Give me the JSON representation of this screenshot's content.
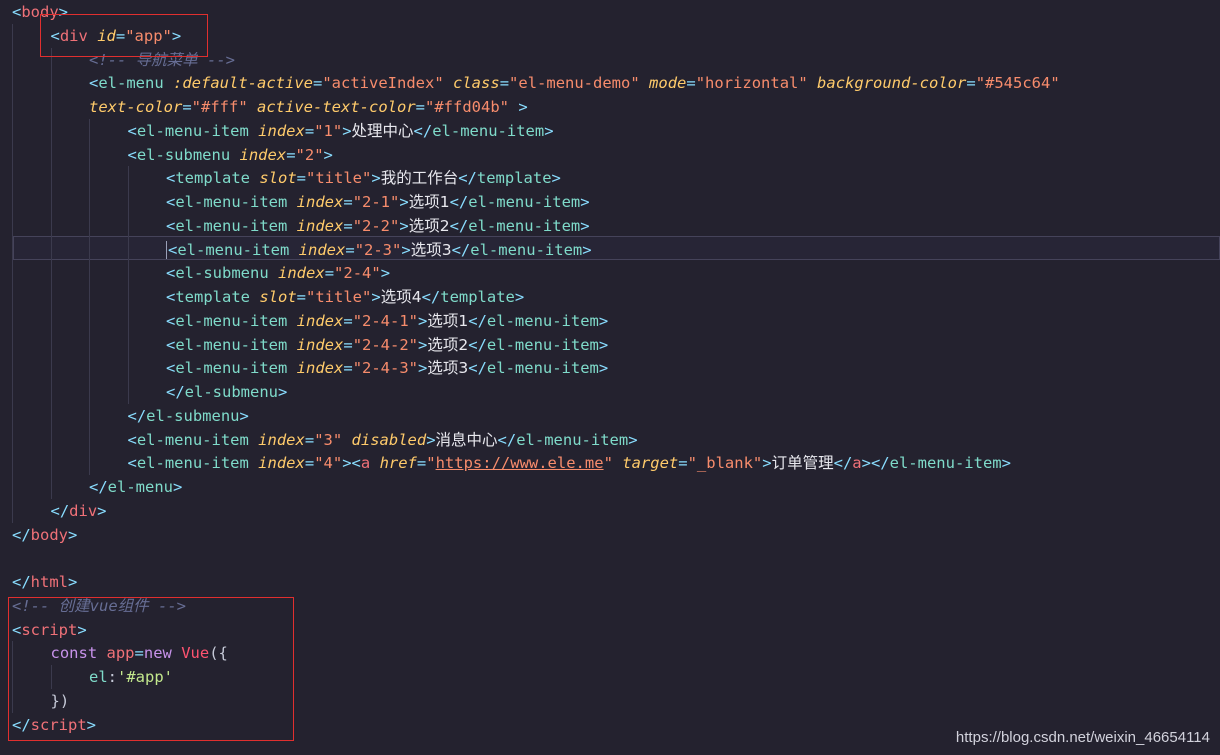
{
  "lines": [
    {
      "indent": 0,
      "tokens": [
        {
          "c": "tag",
          "t": "<"
        },
        {
          "c": "name",
          "t": "body"
        },
        {
          "c": "tag",
          "t": ">"
        }
      ]
    },
    {
      "indent": 1,
      "tokens": [
        {
          "c": "tag",
          "t": "<"
        },
        {
          "c": "name",
          "t": "div"
        },
        {
          "c": "punc",
          "t": " "
        },
        {
          "c": "attr",
          "t": "id"
        },
        {
          "c": "tag",
          "t": "="
        },
        {
          "c": "val",
          "t": "\"app\""
        },
        {
          "c": "tag",
          "t": ">"
        }
      ]
    },
    {
      "indent": 2,
      "tokens": [
        {
          "c": "cmt",
          "t": "<!-- 导航菜单 -->"
        }
      ]
    },
    {
      "indent": 2,
      "tokens": [
        {
          "c": "tag",
          "t": "<"
        },
        {
          "c": "el",
          "t": "el-menu"
        },
        {
          "c": "punc",
          "t": " "
        },
        {
          "c": "attr",
          "t": ":default-active"
        },
        {
          "c": "tag",
          "t": "="
        },
        {
          "c": "val",
          "t": "\"activeIndex\""
        },
        {
          "c": "punc",
          "t": " "
        },
        {
          "c": "attr",
          "t": "class"
        },
        {
          "c": "tag",
          "t": "="
        },
        {
          "c": "val",
          "t": "\"el-menu-demo\""
        },
        {
          "c": "punc",
          "t": " "
        },
        {
          "c": "attr",
          "t": "mode"
        },
        {
          "c": "tag",
          "t": "="
        },
        {
          "c": "val",
          "t": "\"horizontal\""
        },
        {
          "c": "punc",
          "t": " "
        },
        {
          "c": "attr",
          "t": "background-color"
        },
        {
          "c": "tag",
          "t": "="
        },
        {
          "c": "val",
          "t": "\"#545c64\""
        }
      ]
    },
    {
      "indent": 2,
      "tokens": [
        {
          "c": "attr",
          "t": "text-color"
        },
        {
          "c": "tag",
          "t": "="
        },
        {
          "c": "val",
          "t": "\"#fff\""
        },
        {
          "c": "punc",
          "t": " "
        },
        {
          "c": "attr",
          "t": "active-text-color"
        },
        {
          "c": "tag",
          "t": "="
        },
        {
          "c": "val",
          "t": "\"#ffd04b\""
        },
        {
          "c": "punc",
          "t": " "
        },
        {
          "c": "tag",
          "t": ">"
        }
      ]
    },
    {
      "indent": 3,
      "tokens": [
        {
          "c": "tag",
          "t": "<"
        },
        {
          "c": "el",
          "t": "el-menu-item"
        },
        {
          "c": "punc",
          "t": " "
        },
        {
          "c": "attr",
          "t": "index"
        },
        {
          "c": "tag",
          "t": "="
        },
        {
          "c": "val",
          "t": "\"1\""
        },
        {
          "c": "tag",
          "t": ">"
        },
        {
          "c": "txt",
          "t": "处理中心"
        },
        {
          "c": "tag",
          "t": "</"
        },
        {
          "c": "el",
          "t": "el-menu-item"
        },
        {
          "c": "tag",
          "t": ">"
        }
      ]
    },
    {
      "indent": 3,
      "tokens": [
        {
          "c": "tag",
          "t": "<"
        },
        {
          "c": "el",
          "t": "el-submenu"
        },
        {
          "c": "punc",
          "t": " "
        },
        {
          "c": "attr",
          "t": "index"
        },
        {
          "c": "tag",
          "t": "="
        },
        {
          "c": "val",
          "t": "\"2\""
        },
        {
          "c": "tag",
          "t": ">"
        }
      ]
    },
    {
      "indent": 4,
      "tokens": [
        {
          "c": "tag",
          "t": "<"
        },
        {
          "c": "el",
          "t": "template"
        },
        {
          "c": "punc",
          "t": " "
        },
        {
          "c": "attr",
          "t": "slot"
        },
        {
          "c": "tag",
          "t": "="
        },
        {
          "c": "val",
          "t": "\"title\""
        },
        {
          "c": "tag",
          "t": ">"
        },
        {
          "c": "txt",
          "t": "我的工作台"
        },
        {
          "c": "tag",
          "t": "</"
        },
        {
          "c": "el",
          "t": "template"
        },
        {
          "c": "tag",
          "t": ">"
        }
      ]
    },
    {
      "indent": 4,
      "tokens": [
        {
          "c": "tag",
          "t": "<"
        },
        {
          "c": "el",
          "t": "el-menu-item"
        },
        {
          "c": "punc",
          "t": " "
        },
        {
          "c": "attr",
          "t": "index"
        },
        {
          "c": "tag",
          "t": "="
        },
        {
          "c": "val",
          "t": "\"2-1\""
        },
        {
          "c": "tag",
          "t": ">"
        },
        {
          "c": "txt",
          "t": "选项1"
        },
        {
          "c": "tag",
          "t": "</"
        },
        {
          "c": "el",
          "t": "el-menu-item"
        },
        {
          "c": "tag",
          "t": ">"
        }
      ]
    },
    {
      "indent": 4,
      "tokens": [
        {
          "c": "tag",
          "t": "<"
        },
        {
          "c": "el",
          "t": "el-menu-item"
        },
        {
          "c": "punc",
          "t": " "
        },
        {
          "c": "attr",
          "t": "index"
        },
        {
          "c": "tag",
          "t": "="
        },
        {
          "c": "val",
          "t": "\"2-2\""
        },
        {
          "c": "tag",
          "t": ">"
        },
        {
          "c": "txt",
          "t": "选项2"
        },
        {
          "c": "tag",
          "t": "</"
        },
        {
          "c": "el",
          "t": "el-menu-item"
        },
        {
          "c": "tag",
          "t": ">"
        }
      ]
    },
    {
      "indent": 4,
      "current": true,
      "tokens": [
        {
          "c": "tag",
          "t": "<"
        },
        {
          "c": "el",
          "t": "el-menu-item"
        },
        {
          "c": "punc",
          "t": " "
        },
        {
          "c": "attr",
          "t": "index"
        },
        {
          "c": "tag",
          "t": "="
        },
        {
          "c": "val",
          "t": "\"2-3\""
        },
        {
          "c": "tag",
          "t": ">"
        },
        {
          "c": "txt",
          "t": "选项3"
        },
        {
          "c": "tag",
          "t": "</"
        },
        {
          "c": "el",
          "t": "el-menu-item"
        },
        {
          "c": "tag",
          "t": ">"
        }
      ]
    },
    {
      "indent": 4,
      "tokens": [
        {
          "c": "tag",
          "t": "<"
        },
        {
          "c": "el",
          "t": "el-submenu"
        },
        {
          "c": "punc",
          "t": " "
        },
        {
          "c": "attr",
          "t": "index"
        },
        {
          "c": "tag",
          "t": "="
        },
        {
          "c": "val",
          "t": "\"2-4\""
        },
        {
          "c": "tag",
          "t": ">"
        }
      ]
    },
    {
      "indent": 4,
      "tokens": [
        {
          "c": "tag",
          "t": "<"
        },
        {
          "c": "el",
          "t": "template"
        },
        {
          "c": "punc",
          "t": " "
        },
        {
          "c": "attr",
          "t": "slot"
        },
        {
          "c": "tag",
          "t": "="
        },
        {
          "c": "val",
          "t": "\"title\""
        },
        {
          "c": "tag",
          "t": ">"
        },
        {
          "c": "txt",
          "t": "选项4"
        },
        {
          "c": "tag",
          "t": "</"
        },
        {
          "c": "el",
          "t": "template"
        },
        {
          "c": "tag",
          "t": ">"
        }
      ]
    },
    {
      "indent": 4,
      "tokens": [
        {
          "c": "tag",
          "t": "<"
        },
        {
          "c": "el",
          "t": "el-menu-item"
        },
        {
          "c": "punc",
          "t": " "
        },
        {
          "c": "attr",
          "t": "index"
        },
        {
          "c": "tag",
          "t": "="
        },
        {
          "c": "val",
          "t": "\"2-4-1\""
        },
        {
          "c": "tag",
          "t": ">"
        },
        {
          "c": "txt",
          "t": "选项1"
        },
        {
          "c": "tag",
          "t": "</"
        },
        {
          "c": "el",
          "t": "el-menu-item"
        },
        {
          "c": "tag",
          "t": ">"
        }
      ]
    },
    {
      "indent": 4,
      "tokens": [
        {
          "c": "tag",
          "t": "<"
        },
        {
          "c": "el",
          "t": "el-menu-item"
        },
        {
          "c": "punc",
          "t": " "
        },
        {
          "c": "attr",
          "t": "index"
        },
        {
          "c": "tag",
          "t": "="
        },
        {
          "c": "val",
          "t": "\"2-4-2\""
        },
        {
          "c": "tag",
          "t": ">"
        },
        {
          "c": "txt",
          "t": "选项2"
        },
        {
          "c": "tag",
          "t": "</"
        },
        {
          "c": "el",
          "t": "el-menu-item"
        },
        {
          "c": "tag",
          "t": ">"
        }
      ]
    },
    {
      "indent": 4,
      "tokens": [
        {
          "c": "tag",
          "t": "<"
        },
        {
          "c": "el",
          "t": "el-menu-item"
        },
        {
          "c": "punc",
          "t": " "
        },
        {
          "c": "attr",
          "t": "index"
        },
        {
          "c": "tag",
          "t": "="
        },
        {
          "c": "val",
          "t": "\"2-4-3\""
        },
        {
          "c": "tag",
          "t": ">"
        },
        {
          "c": "txt",
          "t": "选项3"
        },
        {
          "c": "tag",
          "t": "</"
        },
        {
          "c": "el",
          "t": "el-menu-item"
        },
        {
          "c": "tag",
          "t": ">"
        }
      ]
    },
    {
      "indent": 4,
      "tokens": [
        {
          "c": "tag",
          "t": "</"
        },
        {
          "c": "el",
          "t": "el-submenu"
        },
        {
          "c": "tag",
          "t": ">"
        }
      ]
    },
    {
      "indent": 3,
      "tokens": [
        {
          "c": "tag",
          "t": "</"
        },
        {
          "c": "el",
          "t": "el-submenu"
        },
        {
          "c": "tag",
          "t": ">"
        }
      ]
    },
    {
      "indent": 3,
      "tokens": [
        {
          "c": "tag",
          "t": "<"
        },
        {
          "c": "el",
          "t": "el-menu-item"
        },
        {
          "c": "punc",
          "t": " "
        },
        {
          "c": "attr",
          "t": "index"
        },
        {
          "c": "tag",
          "t": "="
        },
        {
          "c": "val",
          "t": "\"3\""
        },
        {
          "c": "punc",
          "t": " "
        },
        {
          "c": "attr",
          "t": "disabled"
        },
        {
          "c": "tag",
          "t": ">"
        },
        {
          "c": "txt",
          "t": "消息中心"
        },
        {
          "c": "tag",
          "t": "</"
        },
        {
          "c": "el",
          "t": "el-menu-item"
        },
        {
          "c": "tag",
          "t": ">"
        }
      ]
    },
    {
      "indent": 3,
      "tokens": [
        {
          "c": "tag",
          "t": "<"
        },
        {
          "c": "el",
          "t": "el-menu-item"
        },
        {
          "c": "punc",
          "t": " "
        },
        {
          "c": "attr",
          "t": "index"
        },
        {
          "c": "tag",
          "t": "="
        },
        {
          "c": "val",
          "t": "\"4\""
        },
        {
          "c": "tag",
          "t": ">"
        },
        {
          "c": "tag",
          "t": "<"
        },
        {
          "c": "name",
          "t": "a"
        },
        {
          "c": "punc",
          "t": " "
        },
        {
          "c": "attr",
          "t": "href"
        },
        {
          "c": "tag",
          "t": "="
        },
        {
          "c": "val",
          "t": "\""
        },
        {
          "c": "val link",
          "t": "https://www.ele.me"
        },
        {
          "c": "val",
          "t": "\""
        },
        {
          "c": "punc",
          "t": " "
        },
        {
          "c": "attr",
          "t": "target"
        },
        {
          "c": "tag",
          "t": "="
        },
        {
          "c": "val",
          "t": "\"_blank\""
        },
        {
          "c": "tag",
          "t": ">"
        },
        {
          "c": "txt",
          "t": "订单管理"
        },
        {
          "c": "tag",
          "t": "</"
        },
        {
          "c": "name",
          "t": "a"
        },
        {
          "c": "tag",
          "t": ">"
        },
        {
          "c": "tag",
          "t": "</"
        },
        {
          "c": "el",
          "t": "el-menu-item"
        },
        {
          "c": "tag",
          "t": ">"
        }
      ]
    },
    {
      "indent": 2,
      "tokens": [
        {
          "c": "tag",
          "t": "</"
        },
        {
          "c": "el",
          "t": "el-menu"
        },
        {
          "c": "tag",
          "t": ">"
        }
      ]
    },
    {
      "indent": 1,
      "tokens": [
        {
          "c": "tag",
          "t": "</"
        },
        {
          "c": "name",
          "t": "div"
        },
        {
          "c": "tag",
          "t": ">"
        }
      ]
    },
    {
      "indent": 0,
      "tokens": [
        {
          "c": "tag",
          "t": "</"
        },
        {
          "c": "name",
          "t": "body"
        },
        {
          "c": "tag",
          "t": ">"
        }
      ]
    },
    {
      "indent": 0,
      "tokens": []
    },
    {
      "indent": 0,
      "tokens": [
        {
          "c": "tag",
          "t": "</"
        },
        {
          "c": "name",
          "t": "html"
        },
        {
          "c": "tag",
          "t": ">"
        }
      ]
    },
    {
      "indent": 0,
      "tokens": [
        {
          "c": "cmt",
          "t": "<!-- 创建vue组件 -->"
        }
      ]
    },
    {
      "indent": 0,
      "tokens": [
        {
          "c": "tag",
          "t": "<"
        },
        {
          "c": "name",
          "t": "script"
        },
        {
          "c": "tag",
          "t": ">"
        }
      ]
    },
    {
      "indent": 1,
      "tokens": [
        {
          "c": "kw",
          "t": "const"
        },
        {
          "c": "punc",
          "t": " "
        },
        {
          "c": "var",
          "t": "app"
        },
        {
          "c": "tag",
          "t": "="
        },
        {
          "c": "kw",
          "t": "new"
        },
        {
          "c": "punc",
          "t": " "
        },
        {
          "c": "cls",
          "t": "Vue"
        },
        {
          "c": "punc",
          "t": "({"
        }
      ]
    },
    {
      "indent": 2,
      "tokens": [
        {
          "c": "prop",
          "t": "el"
        },
        {
          "c": "punc",
          "t": ":"
        },
        {
          "c": "str",
          "t": "'#app'"
        }
      ]
    },
    {
      "indent": 1,
      "tokens": [
        {
          "c": "punc",
          "t": "})"
        }
      ]
    },
    {
      "indent": 0,
      "tokens": [
        {
          "c": "tag",
          "t": "</"
        },
        {
          "c": "name",
          "t": "script"
        },
        {
          "c": "tag",
          "t": ">"
        }
      ]
    }
  ],
  "watermark": "https://blog.csdn.net/weixin_46654114",
  "colors": {
    "background": "#24222f",
    "tag": "#89ddff",
    "attribute": "#ffcb6b",
    "string": "#f78c6c",
    "comment": "#676e95",
    "highlight_box": "#e02f2f"
  }
}
